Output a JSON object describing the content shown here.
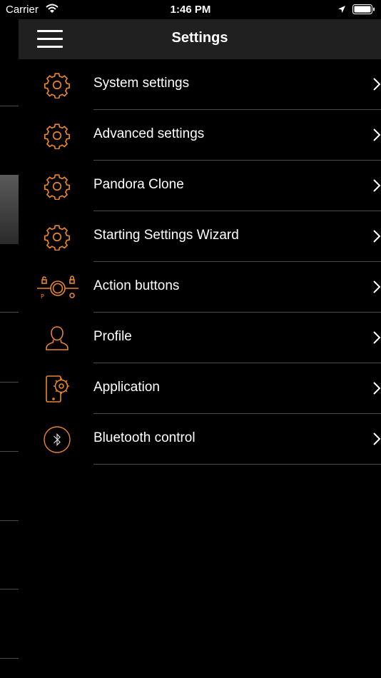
{
  "status_bar": {
    "carrier": "Carrier",
    "time": "1:46 PM"
  },
  "header": {
    "title": "Settings"
  },
  "menu": {
    "items": [
      {
        "label": "System settings",
        "icon": "gear-icon"
      },
      {
        "label": "Advanced settings",
        "icon": "gear-icon"
      },
      {
        "label": "Pandora Clone",
        "icon": "gear-icon"
      },
      {
        "label": "Starting Settings Wizard",
        "icon": "gear-icon"
      },
      {
        "label": "Action buttons",
        "icon": "action-buttons-icon"
      },
      {
        "label": "Profile",
        "icon": "profile-icon"
      },
      {
        "label": "Application",
        "icon": "phone-gear-icon"
      },
      {
        "label": "Bluetooth control",
        "icon": "bluetooth-icon"
      }
    ]
  },
  "colors": {
    "accent": "#e8862a",
    "nav_bg": "#202020",
    "separator": "#4a4a4a"
  }
}
